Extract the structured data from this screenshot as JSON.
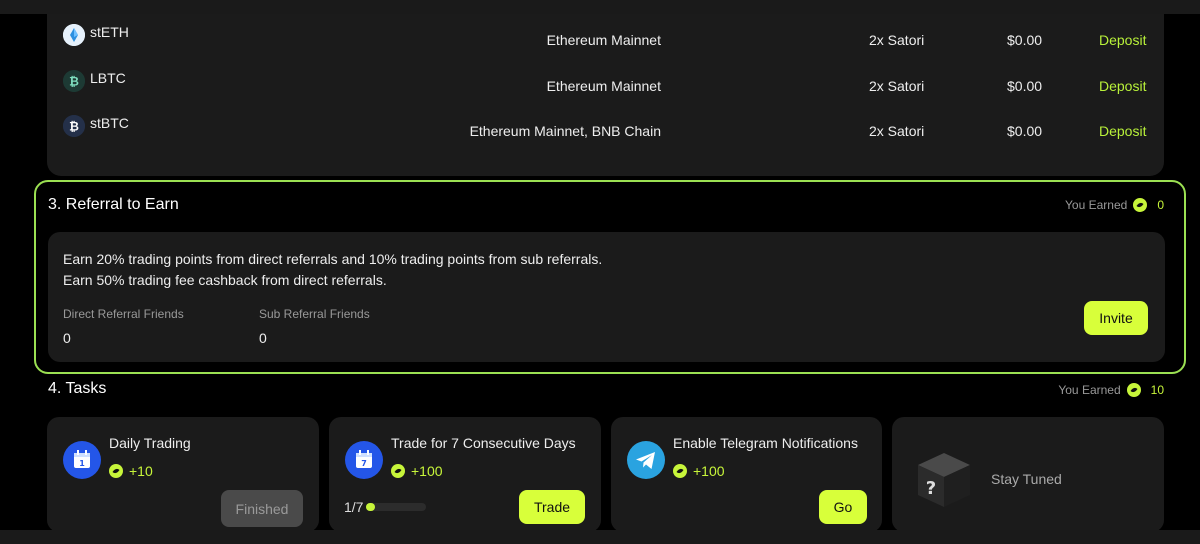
{
  "tokens": [
    {
      "symbol": "stETH",
      "network": "Ethereum Mainnet",
      "multiplier": "2x Satori",
      "amount": "$0.00",
      "action": "Deposit",
      "icon": "steth-icon"
    },
    {
      "symbol": "LBTC",
      "network": "Ethereum Mainnet",
      "multiplier": "2x Satori",
      "amount": "$0.00",
      "action": "Deposit",
      "icon": "lbtc-icon"
    },
    {
      "symbol": "stBTC",
      "network": "Ethereum Mainnet, BNB Chain",
      "multiplier": "2x Satori",
      "amount": "$0.00",
      "action": "Deposit",
      "icon": "stbtc-icon"
    }
  ],
  "referral": {
    "title": "3. Referral to Earn",
    "earned_label": "You Earned",
    "earned_value": "0",
    "line1": "Earn 20% trading points from direct referrals and 10% trading points from sub referrals.",
    "line2": "Earn 50% trading fee cashback from direct referrals.",
    "direct_label": "Direct Referral Friends",
    "direct_value": "0",
    "sub_label": "Sub Referral Friends",
    "sub_value": "0",
    "invite_label": "Invite"
  },
  "tasks": {
    "title": "4. Tasks",
    "earned_label": "You Earned",
    "earned_value": "10",
    "items": [
      {
        "title": "Daily Trading",
        "points": "+10",
        "button": "Finished",
        "icon": "calendar-1-icon"
      },
      {
        "title": "Trade for 7 Consecutive Days",
        "points": "+100",
        "button": "Trade",
        "progress": "1/7",
        "progress_fraction": 0.143,
        "icon": "calendar-7-icon"
      },
      {
        "title": "Enable Telegram Notifications",
        "points": "+100",
        "button": "Go",
        "icon": "telegram-icon"
      },
      {
        "title": "Stay Tuned",
        "icon": "mystery-box-icon"
      }
    ]
  },
  "colors": {
    "accent": "#d8ff3a",
    "points": "#c7f53a",
    "border": "#9be052",
    "card": "#1b1b1b"
  }
}
